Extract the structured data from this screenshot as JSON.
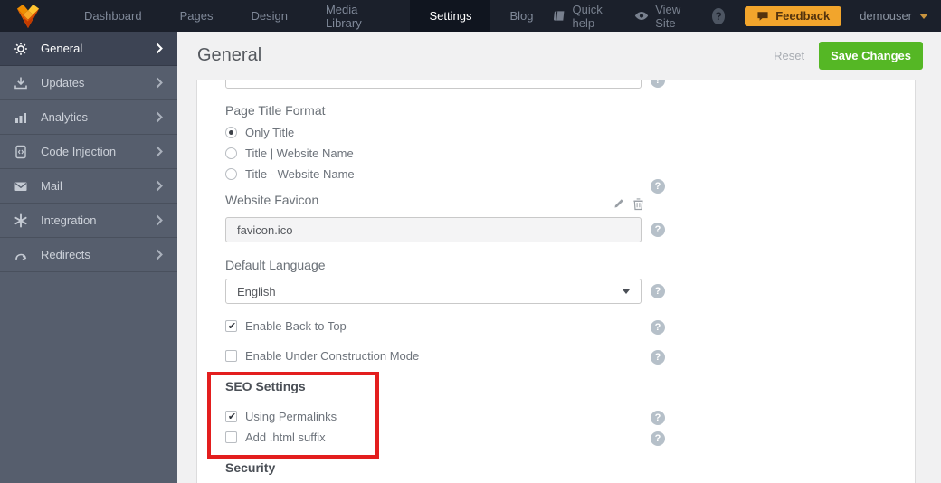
{
  "topnav": {
    "items": [
      {
        "label": "Dashboard"
      },
      {
        "label": "Pages"
      },
      {
        "label": "Design"
      },
      {
        "label": "Media Library"
      },
      {
        "label": "Settings",
        "active": true
      },
      {
        "label": "Blog"
      }
    ],
    "quick_help_label": "Quick help",
    "view_site_label": "View Site",
    "help_badge": "?",
    "feedback_label": "Feedback",
    "username": "demouser"
  },
  "sidebar": {
    "items": [
      {
        "label": "General",
        "icon": "gear-icon",
        "active": true
      },
      {
        "label": "Updates",
        "icon": "download-icon"
      },
      {
        "label": "Analytics",
        "icon": "bar-chart-icon"
      },
      {
        "label": "Code Injection",
        "icon": "code-file-icon"
      },
      {
        "label": "Mail",
        "icon": "envelope-icon"
      },
      {
        "label": "Integration",
        "icon": "asterisk-icon"
      },
      {
        "label": "Redirects",
        "icon": "redirect-icon"
      }
    ]
  },
  "header": {
    "title": "General",
    "reset_label": "Reset",
    "save_label": "Save Changes"
  },
  "form": {
    "page_title_format": {
      "label": "Page Title Format",
      "options": [
        {
          "label": "Only Title",
          "selected": true
        },
        {
          "label": "Title | Website Name",
          "selected": false
        },
        {
          "label": "Title - Website Name",
          "selected": false
        }
      ]
    },
    "website_favicon": {
      "label": "Website Favicon",
      "value": "favicon.ico"
    },
    "default_language": {
      "label": "Default Language",
      "value": "English"
    },
    "enable_back_to_top": {
      "label": "Enable Back to Top",
      "checked": true
    },
    "enable_under_construction": {
      "label": "Enable Under Construction Mode",
      "checked": false
    },
    "seo": {
      "heading": "SEO Settings",
      "using_permalinks": {
        "label": "Using Permalinks",
        "checked": true
      },
      "add_html_suffix": {
        "label": "Add .html suffix",
        "checked": false
      }
    },
    "security_heading": "Security"
  },
  "glyphs": {
    "question": "?"
  },
  "colors": {
    "topnav_bg": "#1b202b",
    "sidebar_bg": "#565e6d",
    "sidebar_active_bg": "#3d4454",
    "save_green": "#55b725",
    "feedback_orange": "#f2a52c",
    "annotation_red": "#e31e1e",
    "page_bg": "#f1f1f2",
    "panel_bg": "#ffffff"
  }
}
